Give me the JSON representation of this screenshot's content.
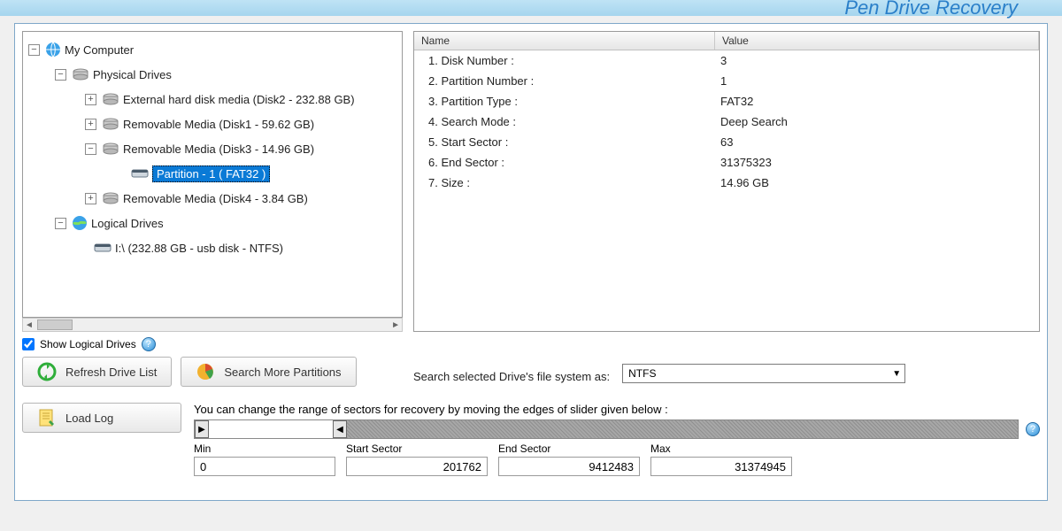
{
  "app": {
    "title": "Pen Drive Recovery"
  },
  "tree": {
    "root_label": "My Computer",
    "phys_label": "Physical Drives",
    "phys_items": [
      {
        "label": "External hard disk media (Disk2 - 232.88 GB)"
      },
      {
        "label": "Removable Media (Disk1 - 59.62 GB)"
      },
      {
        "label": "Removable Media (Disk3 - 14.96 GB)",
        "expanded": true,
        "partition_label": "Partition - 1 ( FAT32 )"
      },
      {
        "label": "Removable Media (Disk4 - 3.84 GB)"
      }
    ],
    "log_label": "Logical Drives",
    "log_items": [
      {
        "label": "I:\\ (232.88 GB - usb disk - NTFS)"
      }
    ]
  },
  "grid": {
    "col_name": "Name",
    "col_value": "Value",
    "rows": [
      {
        "name": "1. Disk Number :",
        "value": "3"
      },
      {
        "name": "2. Partition Number :",
        "value": "1"
      },
      {
        "name": "3. Partition Type :",
        "value": "FAT32"
      },
      {
        "name": "4. Search Mode :",
        "value": "Deep Search"
      },
      {
        "name": "5. Start Sector :",
        "value": "63"
      },
      {
        "name": "6. End Sector :",
        "value": "31375323"
      },
      {
        "name": "7. Size :",
        "value": "14.96 GB"
      }
    ]
  },
  "controls": {
    "show_logical_label": "Show Logical Drives",
    "show_logical_checked": true,
    "refresh_label": "Refresh Drive List",
    "search_more_label": "Search More Partitions",
    "search_as_label": "Search selected Drive's file system as:",
    "fs_selected": "NTFS",
    "load_log_label": "Load Log",
    "slider_caption": "You can change the range of sectors for recovery by moving the edges of slider given below :",
    "min_label": "Min",
    "min_value": "0",
    "start_label": "Start Sector",
    "start_value": "201762",
    "end_label": "End Sector",
    "end_value": "9412483",
    "max_label": "Max",
    "max_value": "31374945"
  }
}
